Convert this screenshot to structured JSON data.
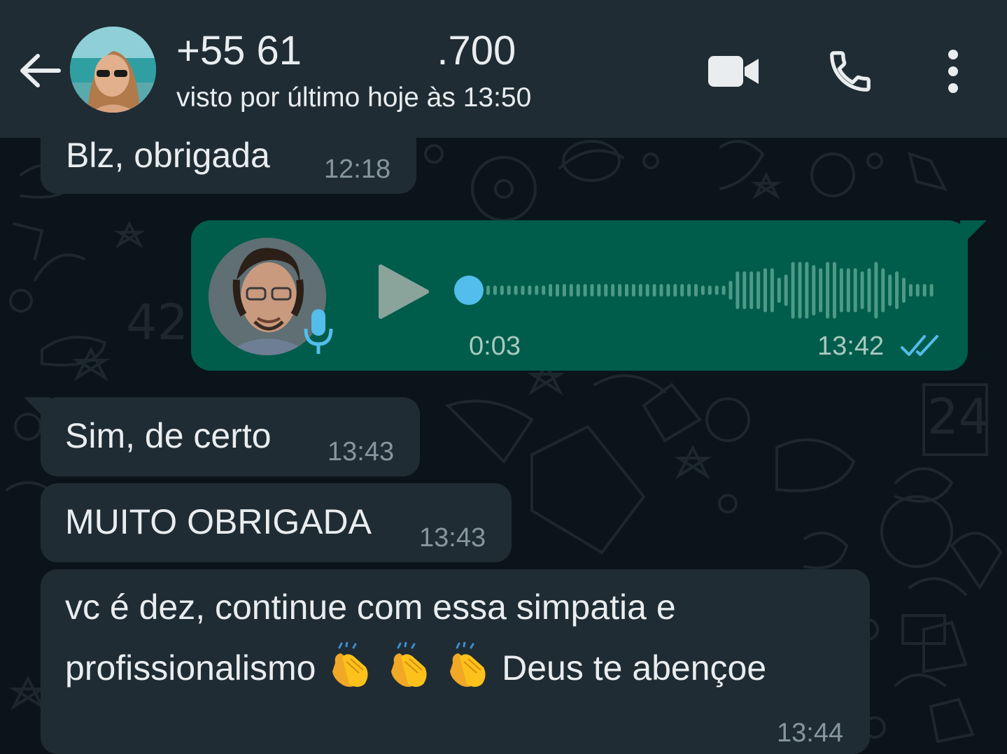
{
  "header": {
    "contact_name": "+55 61            .700",
    "status": "visto por último hoje às 13:50",
    "icons": [
      "back-arrow-icon",
      "video-call-icon",
      "phone-icon",
      "more-vert-icon"
    ]
  },
  "messages": [
    {
      "direction": "in",
      "text": "Blz, obrigada",
      "time": "12:18"
    },
    {
      "direction": "out",
      "type": "voice",
      "duration": "0:03",
      "time": "13:42",
      "status": "read",
      "progress": 0
    },
    {
      "direction": "in",
      "text": "Sim, de certo",
      "time": "13:43"
    },
    {
      "direction": "in",
      "text": "MUITO OBRIGADA",
      "time": "13:43"
    },
    {
      "direction": "in",
      "line1": "vc é dez, continue com essa simpatia e",
      "line2_start": "profissionalismo",
      "line2_end": "Deus te abençoe",
      "emoji": [
        "clapping-hands",
        "clapping-hands",
        "clapping-hands"
      ],
      "time": "13:44"
    }
  ],
  "colors": {
    "header_bg": "#1f2c34",
    "chat_bg": "#0b141a",
    "incoming_bubble": "#202c33",
    "outgoing_bubble": "#005c4b",
    "read_tick": "#53bdeb",
    "play_dot": "#53bdeb"
  }
}
